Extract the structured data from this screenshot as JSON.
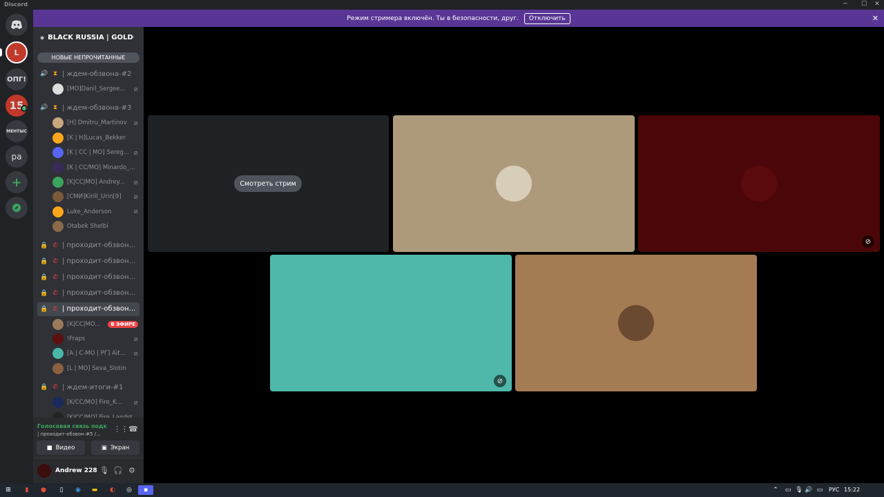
{
  "window": {
    "title": "Discord",
    "controls": [
      "minimize-icon",
      "maximize-icon",
      "close-icon"
    ]
  },
  "guilds": [
    {
      "name": "home",
      "icon": "discord-logo-icon"
    },
    {
      "label": "L",
      "color": "#c0392b"
    },
    {
      "label": "ОПГ!",
      "color": "#36393f"
    },
    {
      "label": "15",
      "color": "#c0392b",
      "badge": "!"
    },
    {
      "label": "МЕНТЫС",
      "color": "#36393f"
    },
    {
      "label": "ра",
      "color": "#36393f"
    },
    {
      "name": "add-server",
      "icon": "plus-icon"
    },
    {
      "name": "explore",
      "icon": "compass-icon"
    }
  ],
  "streamer_banner": {
    "text": "Режим стримера включён. Ты в безопасности, друг.",
    "button": "Отключить"
  },
  "server": {
    "name": "BLACK RUSSIA | GOLD",
    "unread_label": "НОВЫЕ НЕПРОЧИТАННЫЕ"
  },
  "channels": [
    {
      "name": "| ждем-обзвона-#2",
      "users": [
        {
          "name": "[MO]Danil_Sergee...",
          "muted": true,
          "avatar": "#ddd"
        }
      ]
    },
    {
      "name": "| ждем-обзвона-#3",
      "users": [
        {
          "name": "[Н] Dmitru_Martinov",
          "muted": true,
          "avatar": "#c8a87c"
        },
        {
          "name": "[K | H]Lucas_Bekker",
          "muted": false,
          "avatar": "#faa61a"
        },
        {
          "name": "[K | CC | MO] Sereg...",
          "muted": true,
          "avatar": "#5865f2"
        },
        {
          "name": "[K | CC/MO] Minardo_...",
          "muted": false,
          "avatar": "#3a2a5a"
        },
        {
          "name": "[K|CC|MO] Andrey...",
          "muted": true,
          "avatar": "#3ba55d"
        },
        {
          "name": "[СМИ]Kirill_Urin[9]",
          "muted": true,
          "avatar": "#7a5a3a"
        },
        {
          "name": "Luke_Anderson",
          "muted": true,
          "avatar": "#faa61a"
        },
        {
          "name": "Otabek Shelbi",
          "muted": false,
          "avatar": "#8a6a4a"
        }
      ]
    },
    {
      "name": "| проходит-обзвон...",
      "locked": true,
      "users": []
    },
    {
      "name": "| проходит-обзвон...",
      "locked": true,
      "users": []
    },
    {
      "name": "| проходит-обзвон...",
      "locked": true,
      "users": []
    },
    {
      "name": "| проходит-обзвон...",
      "locked": true,
      "users": []
    },
    {
      "name": "| проходит-обзвон...",
      "locked": true,
      "selected": true,
      "users": [
        {
          "name": "[K|CC|MO...",
          "live": "В ЭФИРЕ",
          "avatar": "#9a7a5a"
        },
        {
          "name": "!Fraps",
          "muted": true,
          "avatar": "#5a1010"
        },
        {
          "name": "[A | C-MO | РГ] Ait...",
          "muted": true,
          "avatar": "#4ab7a8"
        },
        {
          "name": "[L | MO] Seva_Slotin",
          "muted": false,
          "avatar": "#8a6040"
        }
      ]
    },
    {
      "name": "| ждем-итоги-#1",
      "locked": true,
      "users": [
        {
          "name": "[K/CC/MO] Fire_K...",
          "muted": true,
          "avatar": "#1a2a5a"
        },
        {
          "name": "[K/CC/MO] Fire_Landst...",
          "muted": false,
          "avatar": "#222"
        }
      ]
    }
  ],
  "voice": {
    "status": "Голосовая связь подк",
    "channel": "| проходит-обзвон-#5 /...",
    "video_label": "Видео",
    "screen_label": "Экран"
  },
  "user": {
    "name": "Andrew 228"
  },
  "stage": {
    "watch_label": "Смотреть стрим",
    "tiles": [
      {
        "kind": "stream",
        "bg": "#1f2224"
      },
      {
        "kind": "avatar",
        "bg": "#ad9a7a",
        "avatar_color": "#d8cdb8"
      },
      {
        "kind": "avatar",
        "bg": "#4a0608",
        "avatar_color": "#5a0a0c",
        "muted": true
      },
      {
        "kind": "avatar",
        "bg": "#4fb8ab",
        "avatar_color": "#4fb8ab",
        "muted": true
      },
      {
        "kind": "avatar",
        "bg": "#a47b52",
        "avatar_color": "#6a4a30"
      }
    ]
  },
  "taskbar": {
    "lang": "РУС",
    "time": "15:22"
  }
}
